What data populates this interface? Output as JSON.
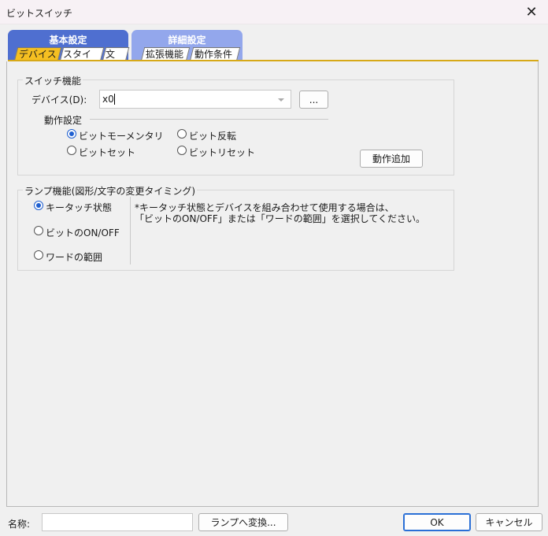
{
  "window": {
    "title": "ビットスイッチ",
    "close_glyph": "✕"
  },
  "tabs": {
    "basic": {
      "label": "基本設定",
      "subtabs": [
        "デバイス",
        "スタイル",
        "文字"
      ]
    },
    "detail": {
      "label": "詳細設定",
      "subtabs": [
        "拡張機能",
        "動作条件"
      ]
    }
  },
  "switch_function": {
    "title": "スイッチ機能",
    "device_label": "デバイス(D):",
    "device_value": "x0",
    "browse_button": "...",
    "operation_title": "動作設定",
    "operations": [
      {
        "label": "ビットモーメンタリ",
        "checked": true
      },
      {
        "label": "ビット反転",
        "checked": false
      },
      {
        "label": "ビットセット",
        "checked": false
      },
      {
        "label": "ビットリセット",
        "checked": false
      }
    ],
    "add_action_button": "動作追加"
  },
  "lamp_function": {
    "title": "ランプ機能(図形/文字の変更タイミング)",
    "options": [
      {
        "label": "キータッチ状態",
        "checked": true
      },
      {
        "label": "ビットのON/OFF",
        "checked": false
      },
      {
        "label": "ワードの範囲",
        "checked": false
      }
    ],
    "note_line1": "*キータッチ状態とデバイスを組み合わせて使用する場合は、",
    "note_line2": "「ビットのON/OFF」または「ワードの範囲」を選択してください。"
  },
  "footer": {
    "name_label": "名称:",
    "name_value": "",
    "convert_button": "ランプへ変換...",
    "ok_button": "OK",
    "cancel_button": "キャンセル"
  }
}
